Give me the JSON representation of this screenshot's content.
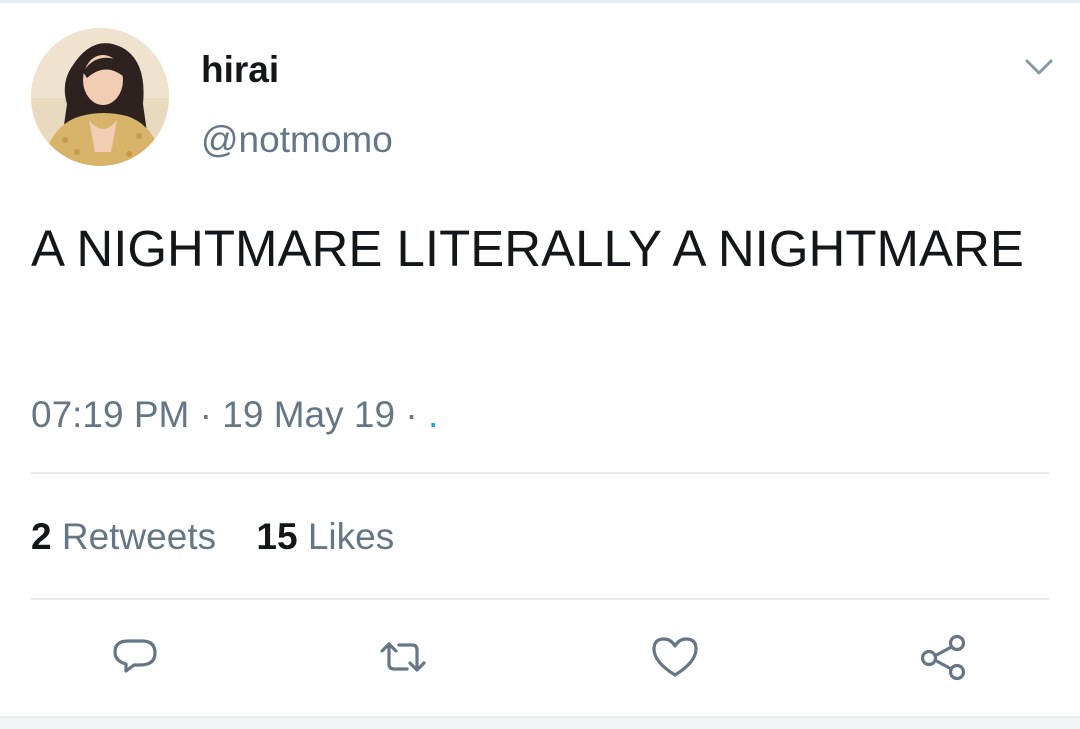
{
  "user": {
    "display_name": "hirai",
    "handle": "@notmomo"
  },
  "tweet": {
    "text": "A NIGHTMARE LITERALLY A NIGHTMARE",
    "time": "07:19 PM",
    "separator": "·",
    "date": "19 May 19",
    "trailing": "·",
    "source_mark": "."
  },
  "stats": {
    "retweets_count": "2",
    "retweets_label": "Retweets",
    "likes_count": "15",
    "likes_label": "Likes"
  },
  "icons": {
    "menu": "chevron-down-icon",
    "reply": "reply-icon",
    "retweet": "retweet-icon",
    "like": "heart-icon",
    "share": "share-icon"
  },
  "colors": {
    "text_primary": "#14171a",
    "text_secondary": "#657786",
    "divider": "#e6ecf0",
    "link": "#1da1f2"
  }
}
